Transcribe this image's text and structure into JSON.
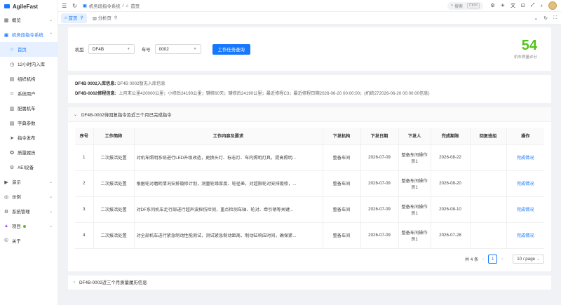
{
  "app": {
    "name": "AgileFast"
  },
  "sidebar": {
    "items": [
      {
        "label": "概览",
        "icon": "grid-icon",
        "arrow": "⌄"
      },
      {
        "label": "机务段指令系统",
        "icon": "monitor-icon",
        "arrow": "⌃"
      },
      {
        "label": "首页",
        "icon": "home-icon"
      },
      {
        "label": "12小时内入库",
        "icon": "clock-icon"
      },
      {
        "label": "组织机构",
        "icon": "org-icon"
      },
      {
        "label": "系统用户",
        "icon": "user-icon"
      },
      {
        "label": "配属机车",
        "icon": "train-icon"
      },
      {
        "label": "字典参数",
        "icon": "book-icon"
      },
      {
        "label": "指令发布",
        "icon": "send-icon"
      },
      {
        "label": "质量履历",
        "icon": "medal-icon"
      },
      {
        "label": "AEI设备",
        "icon": "device-icon"
      },
      {
        "label": "演示",
        "icon": "play-icon",
        "arrow": "⌄"
      },
      {
        "label": "示例",
        "icon": "sample-icon",
        "arrow": "⌄"
      },
      {
        "label": "系统管理",
        "icon": "gear-icon",
        "arrow": "⌄"
      },
      {
        "label": "项目",
        "icon": "project-icon",
        "arrow": "⌄"
      },
      {
        "label": "关于",
        "icon": "info-icon"
      }
    ]
  },
  "topbar": {
    "breadcrumb": [
      "机务段指令系统",
      "首页"
    ],
    "search_placeholder": "搜索",
    "search_kbd": "Ctrl K"
  },
  "tabs": [
    {
      "label": "首页",
      "active": true
    },
    {
      "label": "分析页",
      "active": false
    }
  ],
  "query": {
    "model_label": "机型",
    "model_value": "DF4B",
    "number_label": "车号",
    "number_value": "0002",
    "button": "工作任务查询",
    "score": "54",
    "score_label": "机车质量评分",
    "score_color": "#52c41a"
  },
  "info": {
    "line1_label": "DF4B 0002入库信息:",
    "line1_value": "DF4B 0002暂无入库信息",
    "line2_label": "DF4B-0002修程信息:",
    "line2_value": "上月末公里420000公里；小修后24190公里；辅修60天；辅修后24190公里；最近修程C3；最近修程日期2026-06-20 00:00:00；(机统272026-06-20 00:00:00信息)"
  },
  "panel1": {
    "title": "DF4B-0002待回复指令及近三个月已完成指令",
    "columns": [
      "序号",
      "工作简称",
      "工作内容及要求",
      "下发机构",
      "下发日期",
      "下发人",
      "完成期限",
      "回复班组",
      "操作"
    ],
    "rows": [
      {
        "no": "1",
        "name": "二次报活处置",
        "content": "对机车照明系统进行LED升级改造，更换头灯、标志灯、车内照明灯具，提高照明...",
        "org": "整备车间",
        "date": "2026-07-09",
        "person": "整备车间操作员1",
        "deadline": "2026-08-22",
        "team": "",
        "op": "完成情况"
      },
      {
        "no": "2",
        "name": "二次报活处置",
        "content": "根据轮对磨耗情况安排镟修计划，测量轮缘厚度、轮径差，对超限轮对安排镟修，...",
        "org": "整备车间",
        "date": "2026-07-09",
        "person": "整备车间操作员1",
        "deadline": "2026-08-20",
        "team": "",
        "op": "完成情况"
      },
      {
        "no": "3",
        "name": "二次报活处置",
        "content": "对DF系列机车走行部进行超声波探伤检测，重点检测车轴、轮对、牵引销等关键...",
        "org": "整备车间",
        "date": "2026-07-09",
        "person": "整备车间操作员1",
        "deadline": "2026-08-10",
        "team": "",
        "op": "完成情况"
      },
      {
        "no": "4",
        "name": "二次报活处置",
        "content": "对全部机车进行紧急制动性能测试，测试紧急制动距离、制动缸响应时间，确保紧...",
        "org": "整备车间",
        "date": "2026-07-09",
        "person": "整备车间操作员1",
        "deadline": "2026-07-28",
        "team": "",
        "op": "完成情况"
      }
    ],
    "total": "共 4 条",
    "page": "1",
    "page_size": "10 / page"
  },
  "panel2": {
    "title": "DF4B-0002近三个月质量履历信息"
  }
}
